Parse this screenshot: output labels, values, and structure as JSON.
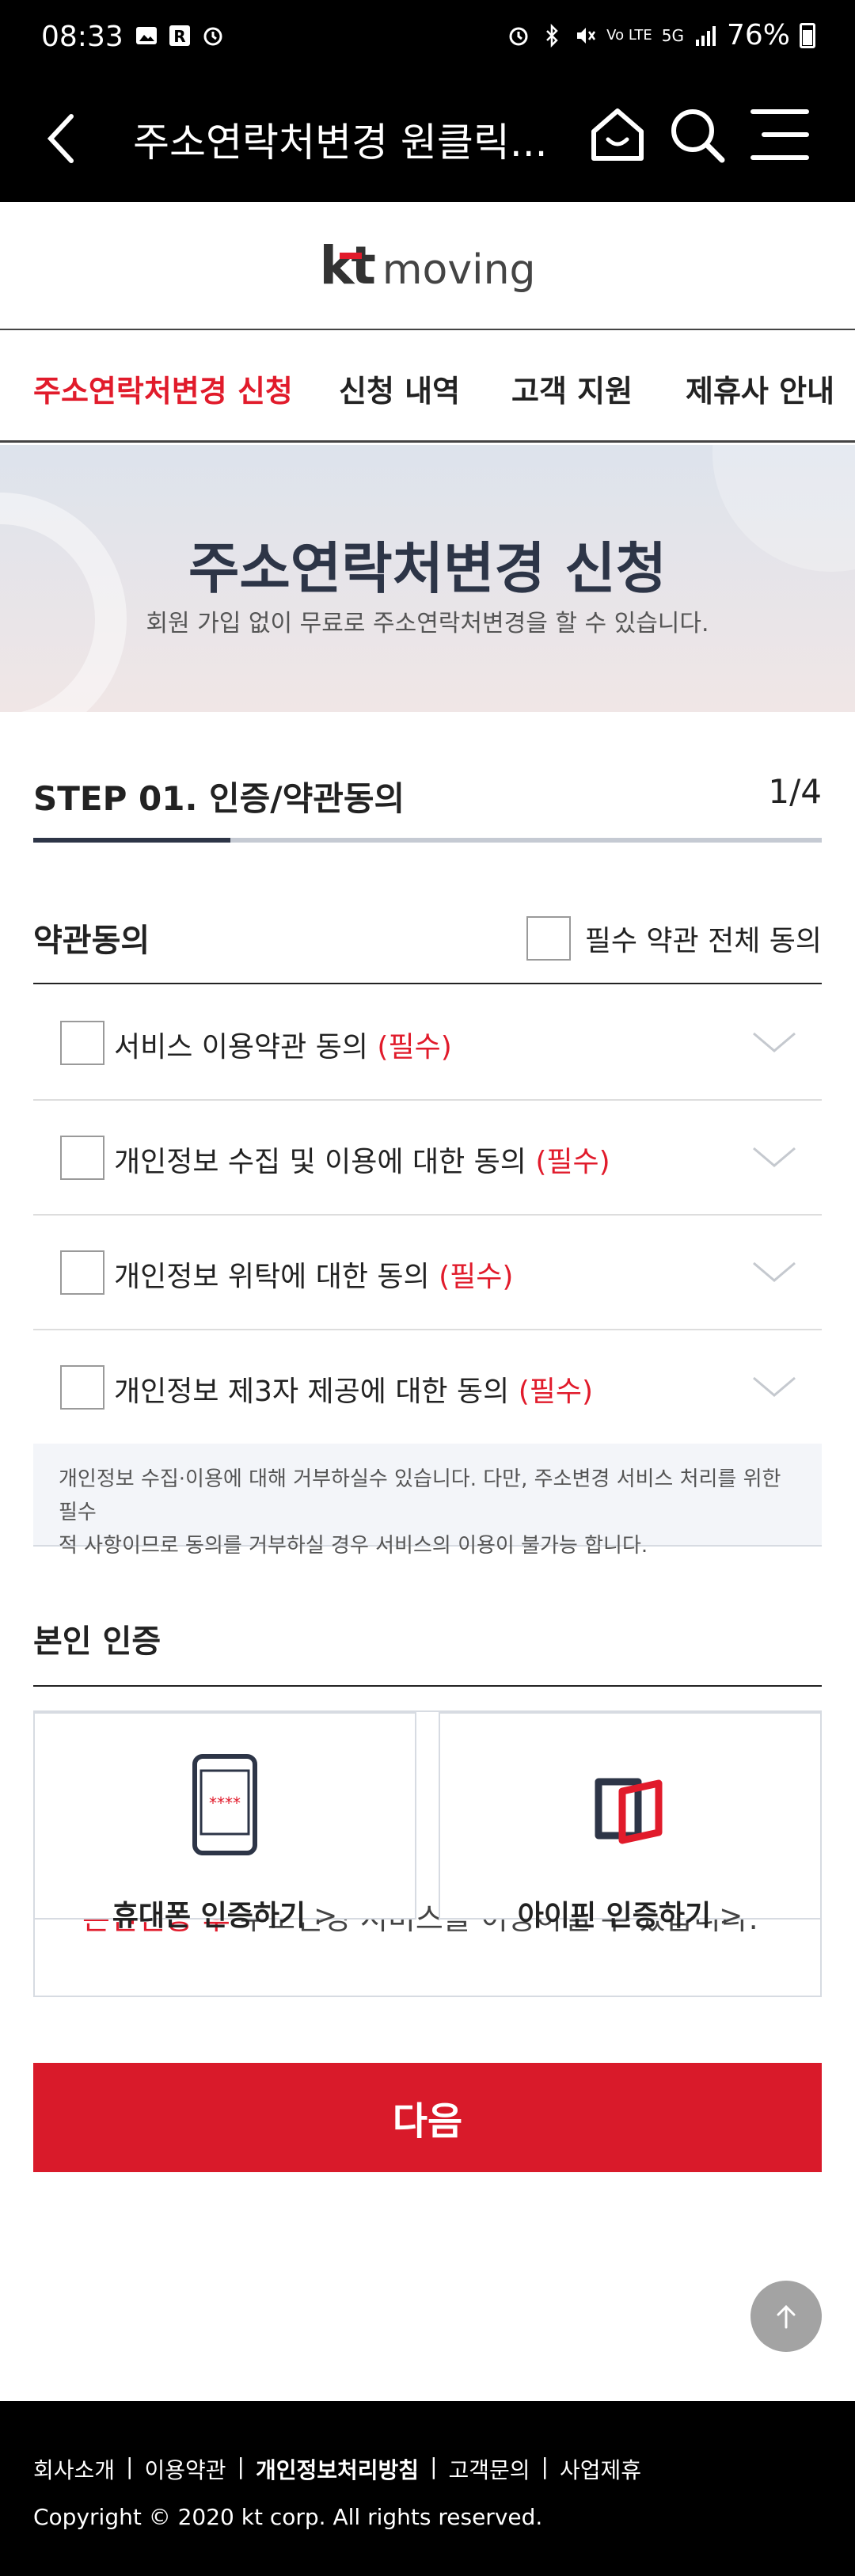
{
  "status_bar": {
    "time": "08:33",
    "battery": "76%",
    "network": "5G",
    "lte_label": "Vo LTE"
  },
  "app_bar": {
    "title": "주소연락처변경 원클릭..."
  },
  "logo": {
    "kt": "kt",
    "moving": "moving"
  },
  "nav": {
    "tabs": [
      "주소연락처변경 신청",
      "신청 내역",
      "고객 지원",
      "제휴사 안내"
    ]
  },
  "hero": {
    "title": "주소연락처변경 신청",
    "subtitle": "회원 가입 없이 무료로 주소연락처변경을 할 수 있습니다."
  },
  "step": {
    "label": "STEP 01. 인증/약관동의",
    "count": "1/4",
    "progress": 0.25
  },
  "terms": {
    "title": "약관동의",
    "agree_all": "필수 약관 전체 동의",
    "items": [
      {
        "text": "서비스 이용약관 동의",
        "required": "(필수)"
      },
      {
        "text": "개인정보 수집 및 이용에 대한 동의",
        "required": "(필수)"
      },
      {
        "text": "개인정보 위탁에 대한 동의",
        "required": "(필수)"
      },
      {
        "text": "개인정보 제3자 제공에 대한 동의",
        "required": "(필수)"
      }
    ],
    "notice_line1": "개인정보 수집·이용에 대해 거부하실수 있습니다. 다만, 주소변경 서비스 처리를 위한 필수",
    "notice_line2": "적 사항이므로 동의를 거부하실 경우 서비스의 이용이 불가능 합니다."
  },
  "identity": {
    "title": "본인 인증",
    "behind_red": "본인인증 후",
    "behind_text": "주소변경 서비스를 이용하실 수 있습니다.",
    "phone_label": "휴대폰 인증하기",
    "ipin_label": "아이핀 인증하기",
    "arrow": ">"
  },
  "next_button": "다음",
  "footer": {
    "links": [
      "회사소개",
      "이용약관",
      "개인정보처리방침",
      "고객문의",
      "사업제휴"
    ],
    "copyright": "Copyright © 2020 kt corp. All rights reserved."
  },
  "colors": {
    "accent": "#d91a2a",
    "dark": "#2d3547"
  }
}
